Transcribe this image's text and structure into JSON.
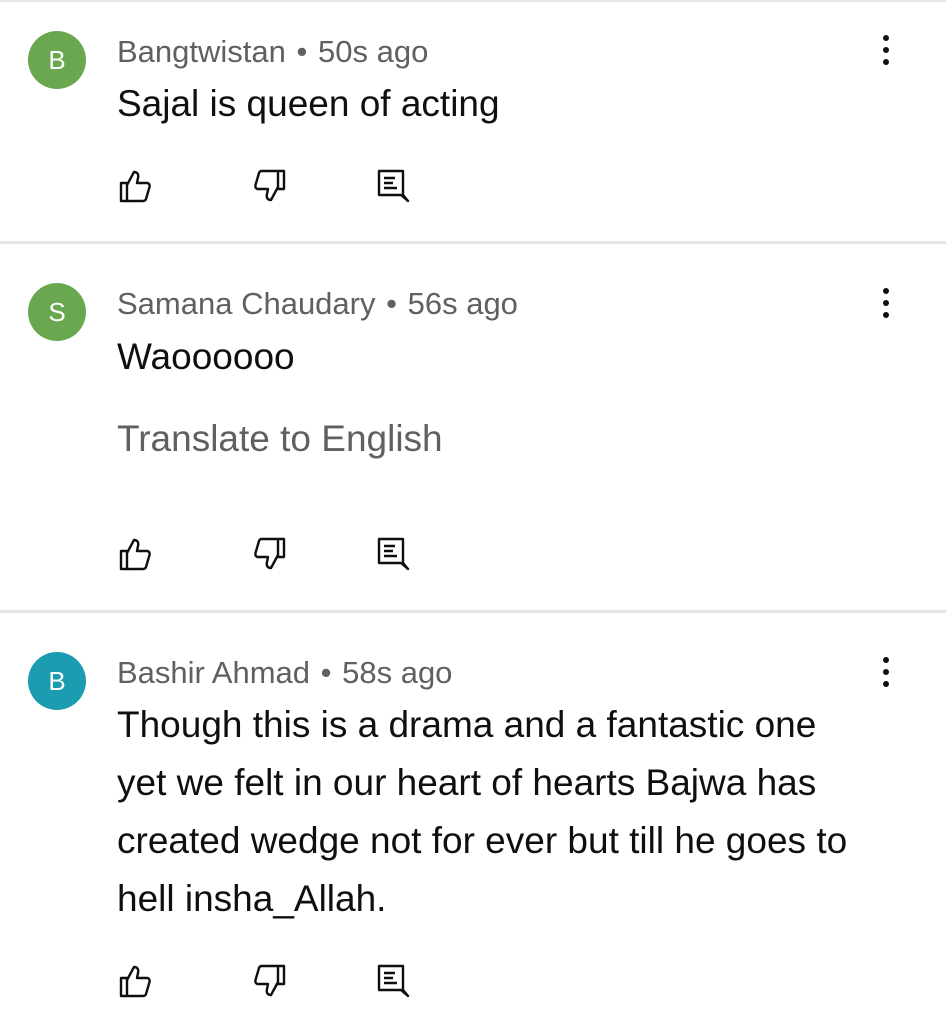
{
  "comments": [
    {
      "avatar_letter": "B",
      "avatar_color": "#6aa84f",
      "author": "Bangtwistan",
      "separator": "•",
      "time": "50s ago",
      "text": "Sajal is queen of acting",
      "translate_label": ""
    },
    {
      "avatar_letter": "S",
      "avatar_color": "#6aa84f",
      "author": "Samana Chaudary",
      "separator": "•",
      "time": "56s ago",
      "text": "Waoooooo",
      "translate_label": "Translate to English"
    },
    {
      "avatar_letter": "B",
      "avatar_color": "#1b9cb0",
      "author": "Bashir Ahmad",
      "separator": "•",
      "time": "58s ago",
      "text": "Though this is a drama and a fantastic one yet we felt in our heart of hearts Bajwa has created wedge not for ever but till he goes to hell insha_Allah.",
      "translate_label": ""
    }
  ],
  "icons": {
    "like": "thumbs-up-icon",
    "dislike": "thumbs-down-icon",
    "reply": "reply-comment-icon",
    "menu": "more-vertical-icon"
  },
  "colors": {
    "text_primary": "#0f0f0f",
    "text_secondary": "#606060",
    "divider": "#e5e5e5"
  }
}
